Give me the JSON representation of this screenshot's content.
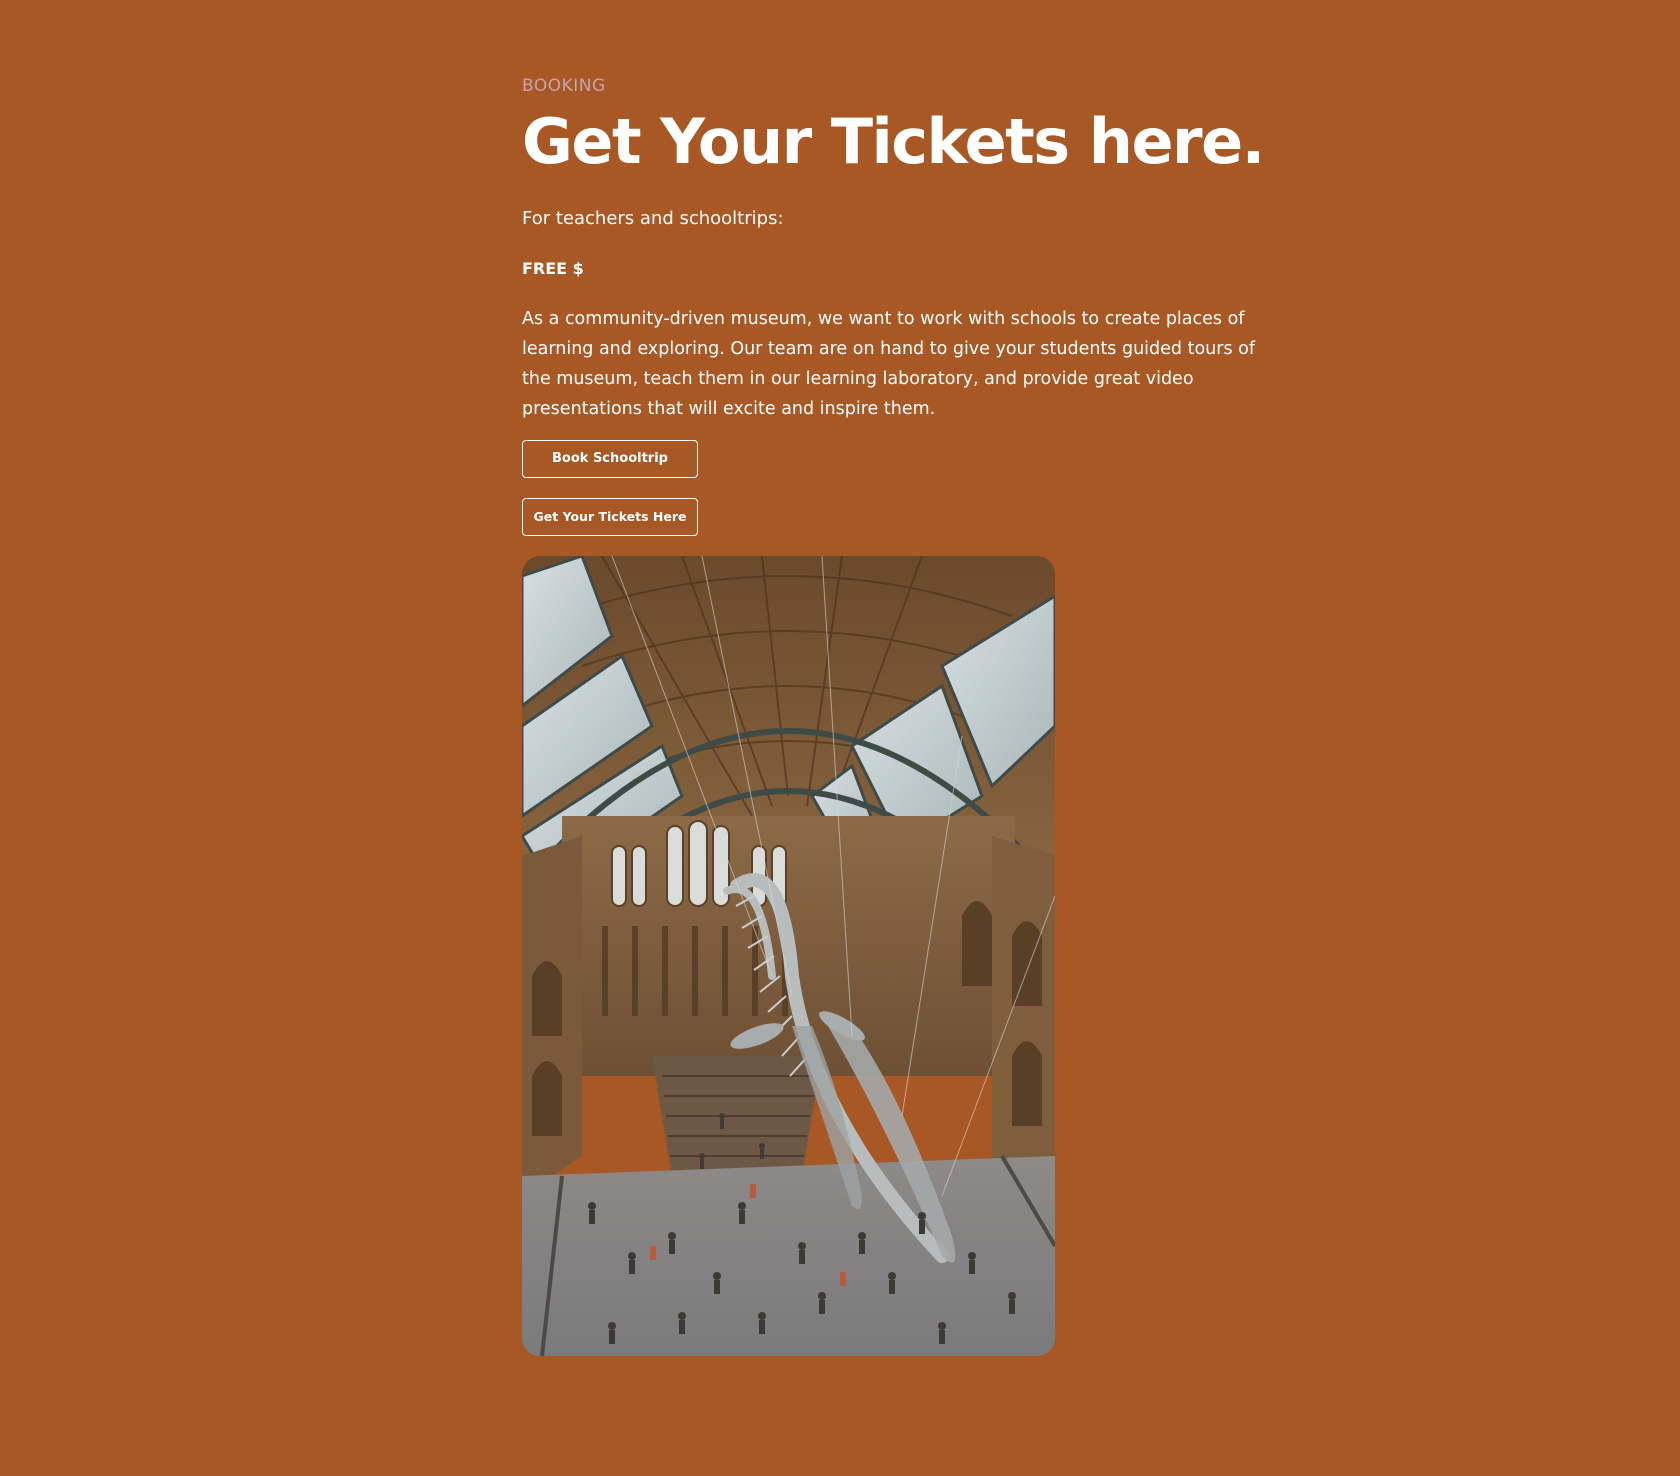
{
  "booking": {
    "eyebrow": "BOOKING",
    "title": "Get Your Tickets here.",
    "lead": "For teachers and schooltrips:",
    "price": "FREE $",
    "description": "As a community-driven museum, we want to work with schools to create places of learning and exploring. Our team are on hand to give your students guided tours of the museum, teach them in our learning laboratory, and provide great video presentations that will excite and inspire them.",
    "buttons": {
      "book_schooltrip": "Book Schooltrip",
      "get_tickets": "Get Your Tickets Here"
    }
  },
  "colors": {
    "background": "#a85824",
    "eyebrow": "#c9a3b0",
    "text": "#ffffff"
  }
}
